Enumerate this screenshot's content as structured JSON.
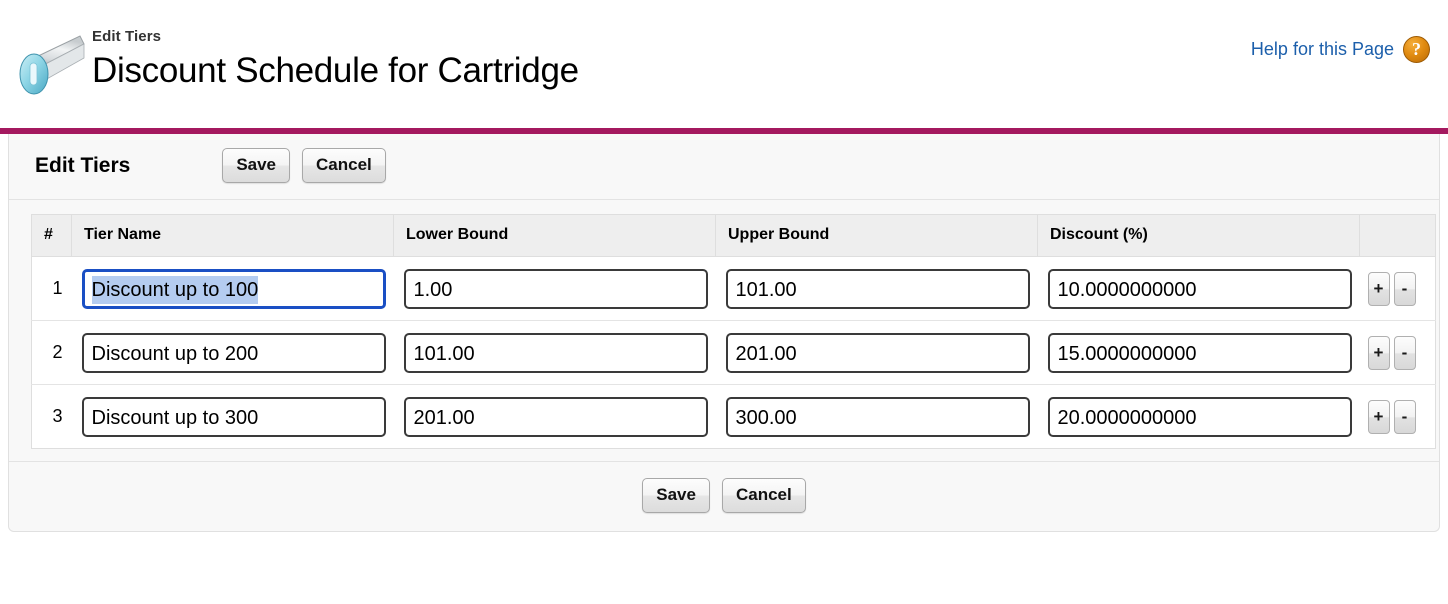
{
  "header": {
    "eyebrow": "Edit Tiers",
    "title": "Discount Schedule for Cartridge",
    "help_label": "Help for this Page",
    "help_icon_glyph": "?",
    "object_icon": "discount-schedule-icon",
    "accent_color": "#a4195f",
    "link_color": "#1c5fab"
  },
  "toolbar": {
    "section_title": "Edit Tiers",
    "save_label": "Save",
    "cancel_label": "Cancel"
  },
  "table": {
    "columns": [
      {
        "key": "num",
        "label": "#"
      },
      {
        "key": "name",
        "label": "Tier Name"
      },
      {
        "key": "low",
        "label": "Lower Bound"
      },
      {
        "key": "up",
        "label": "Upper Bound"
      },
      {
        "key": "disc",
        "label": "Discount (%)"
      },
      {
        "key": "act",
        "label": ""
      }
    ],
    "rows": [
      {
        "num": "1",
        "name": "Discount up to 100",
        "low": "1.00",
        "up": "101.00",
        "disc": "10.0000000000",
        "focused_field": "name",
        "name_selected": true,
        "add_label": "+",
        "remove_label": "-"
      },
      {
        "num": "2",
        "name": "Discount up to 200",
        "low": "101.00",
        "up": "201.00",
        "disc": "15.0000000000",
        "focused_field": "",
        "name_selected": false,
        "add_label": "+",
        "remove_label": "-"
      },
      {
        "num": "3",
        "name": "Discount up to 300",
        "low": "201.00",
        "up": "300.00",
        "disc": "20.0000000000",
        "focused_field": "",
        "name_selected": false,
        "add_label": "+",
        "remove_label": "-"
      }
    ]
  },
  "footer": {
    "save_label": "Save",
    "cancel_label": "Cancel"
  }
}
